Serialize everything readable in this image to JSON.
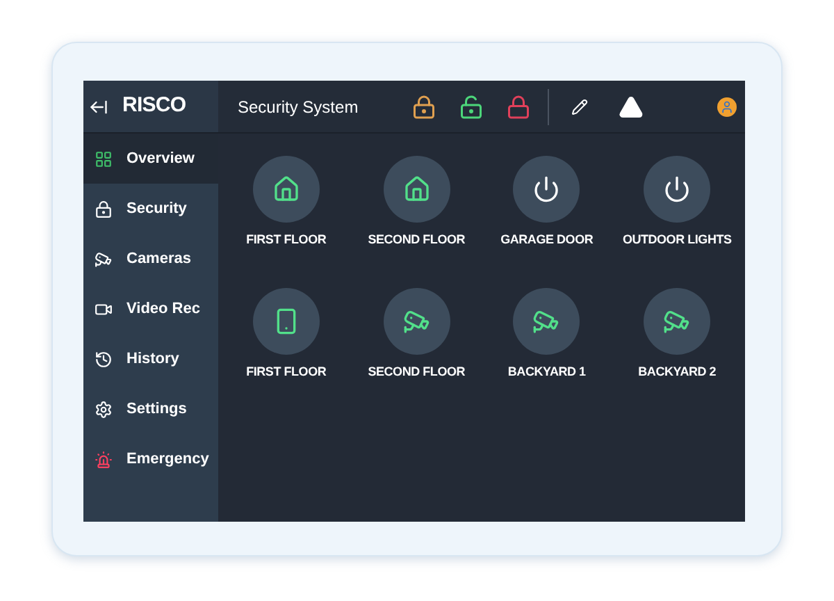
{
  "header": {
    "logo": "RISCO",
    "title": "Security System",
    "locks": [
      {
        "kind": "partial",
        "color": "#e0a050"
      },
      {
        "kind": "open",
        "color": "#4cd67a"
      },
      {
        "kind": "closed",
        "color": "#e0405a"
      }
    ]
  },
  "sidebar": {
    "items": [
      {
        "label": "Overview",
        "kind": "overview",
        "selected": true
      },
      {
        "label": "Security",
        "kind": "security",
        "selected": false
      },
      {
        "label": "Cameras",
        "kind": "cameras",
        "selected": false
      },
      {
        "label": "Video Rec",
        "kind": "video",
        "selected": false
      },
      {
        "label": "History",
        "kind": "history",
        "selected": false
      },
      {
        "label": "Settings",
        "kind": "settings",
        "selected": false
      },
      {
        "label": "Emergency",
        "kind": "emergency",
        "selected": false
      }
    ]
  },
  "tiles": [
    {
      "label": "FIRST FLOOR",
      "kind": "home"
    },
    {
      "label": "SECOND FLOOR",
      "kind": "home"
    },
    {
      "label": "GARAGE DOOR",
      "kind": "power"
    },
    {
      "label": "OUTDOOR LIGHTS",
      "kind": "power"
    },
    {
      "label": "FIRST FLOOR",
      "kind": "sensor"
    },
    {
      "label": "SECOND FLOOR",
      "kind": "camera"
    },
    {
      "label": "BACKYARD 1",
      "kind": "camera"
    },
    {
      "label": "BACKYARD 2",
      "kind": "camera"
    }
  ]
}
